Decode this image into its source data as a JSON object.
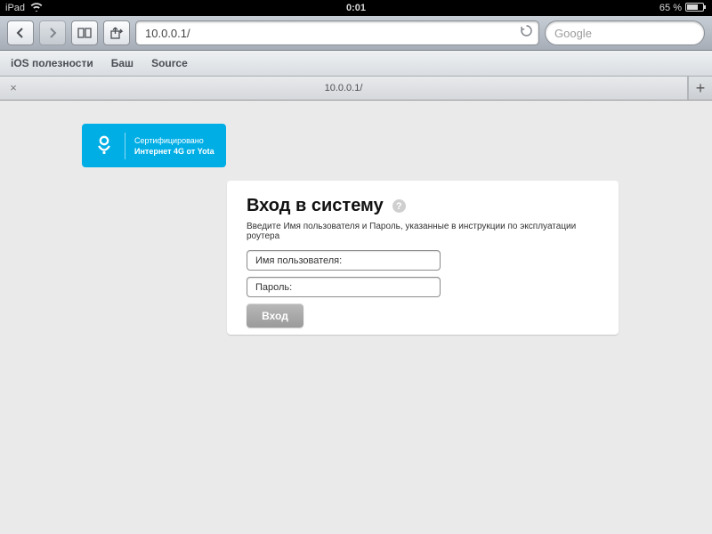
{
  "status": {
    "device": "iPad",
    "time": "0:01",
    "battery_pct": "65 %"
  },
  "toolbar": {
    "url": "10.0.0.1/",
    "search_placeholder": "Google"
  },
  "bookmarks": [
    "iOS полезности",
    "Баш",
    "Source"
  ],
  "tabs": {
    "active_title": "10.0.0.1/"
  },
  "yota": {
    "line1": "Сертифицировано",
    "line2": "Интернет 4G от Yota"
  },
  "login": {
    "title": "Вход в систему",
    "hint": "Введите Имя пользователя и Пароль, указанные в инструкции по эксплуатации роутера",
    "username_label": "Имя пользователя:",
    "password_label": "Пароль:",
    "submit_label": "Вход"
  }
}
